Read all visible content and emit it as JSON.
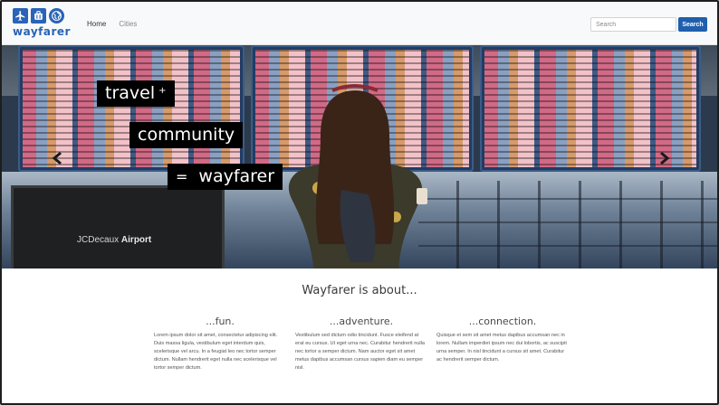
{
  "navbar": {
    "brand_name": "wayfarer",
    "brand_icons": [
      "airplane-icon",
      "luggage-icon",
      "globe-icon"
    ],
    "links": [
      {
        "label": "Home",
        "active": true
      },
      {
        "label": "Cities",
        "active": false
      }
    ],
    "search": {
      "placeholder": "Search",
      "value": ""
    },
    "search_button": "Search"
  },
  "hero": {
    "tags": [
      {
        "text": "travel",
        "suffix": "+"
      },
      {
        "text": "community"
      },
      {
        "prefix": "=",
        "text": "wayfarer"
      }
    ],
    "sign_text_regular": "JCDecaux",
    "sign_text_bold": "Airport",
    "prev_icon": "chevron-left-icon",
    "next_icon": "chevron-right-icon"
  },
  "about": {
    "heading": "Wayfarer is about...",
    "columns": [
      {
        "title": "...fun.",
        "text": "Lorem ipsum dolor sit amet, consectetur adipiscing elit. Duis massa ligula, vestibulum eget interdum quis, scelerisque vel arcu. In a feugiat leo nec tortor semper dictum. Nullam hendrerit eget nulla nec scelerisque vel tortor semper dictum."
      },
      {
        "title": "...adventure.",
        "text": "Vestibulum sed dictum odio tincidunt. Fusce eleifend at erat eu cursus. Ut eget urna nec. Curabitur hendrerit nulla nec tortor a semper dictum. Nam auctor eget sit amet metus dapibus accumsan cursus sapien diam eu semper nisl."
      },
      {
        "title": "...connection.",
        "text": "Quisque et sem sit amet metus dapibus accumsan nec in lorem. Nullam imperdiet ipsum nec dui lobortis, ac suscipit urna semper. In nisl tincidunt a cursus sit amet. Curabitur ac hendrerit semper dictum."
      }
    ]
  },
  "colors": {
    "brand": "#2a63b8",
    "button": "#1f5fad",
    "tag_bg": "#000000"
  }
}
